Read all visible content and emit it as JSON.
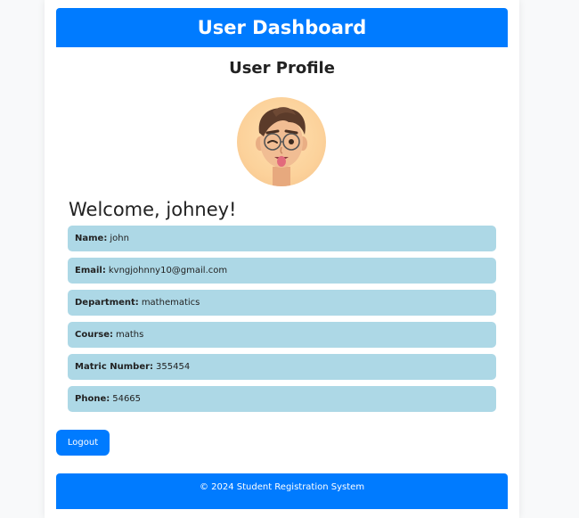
{
  "header": {
    "title": "User Dashboard"
  },
  "profile": {
    "title": "User Profile",
    "welcome": "Welcome, johney!",
    "fields": [
      {
        "label": "Name:",
        "value": "john"
      },
      {
        "label": "Email:",
        "value": "kvngjohnny10@gmail.com"
      },
      {
        "label": "Department:",
        "value": "mathematics"
      },
      {
        "label": "Course:",
        "value": "maths"
      },
      {
        "label": "Matric Number:",
        "value": "355454"
      },
      {
        "label": "Phone:",
        "value": "54665"
      }
    ]
  },
  "actions": {
    "logout_label": "Logout"
  },
  "footer": {
    "text": "© 2024 Student Registration System"
  },
  "colors": {
    "primary": "#007bff",
    "info_bg": "#add8e6",
    "page_bg": "#f8f9fa"
  }
}
